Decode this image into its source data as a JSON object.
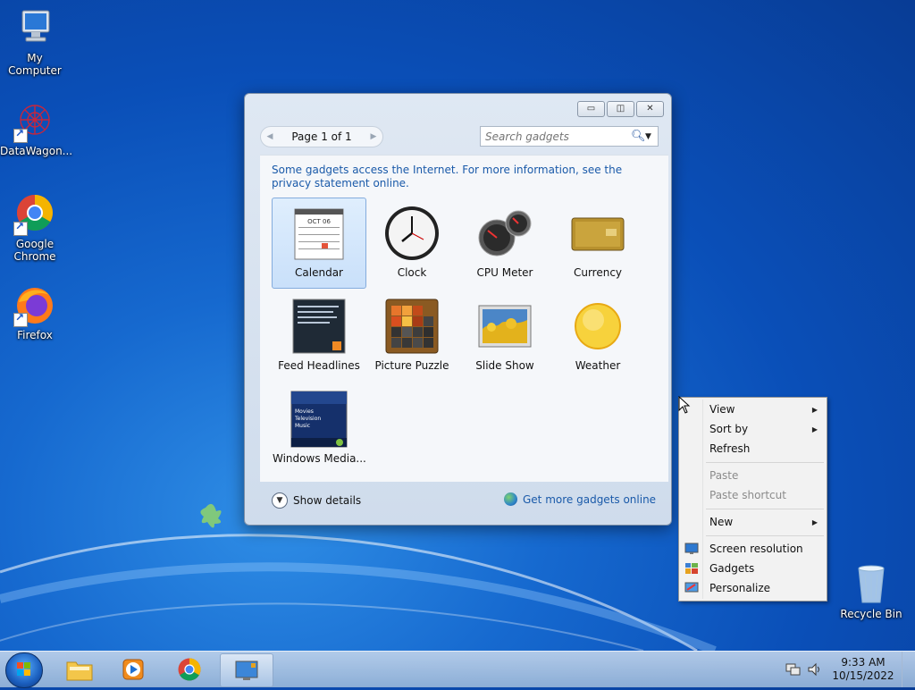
{
  "desktop": {
    "icons": [
      {
        "label": "My Computer"
      },
      {
        "label": "DataWagon..."
      },
      {
        "label": "Google Chrome"
      },
      {
        "label": "Firefox"
      },
      {
        "label": "Recycle Bin"
      }
    ]
  },
  "gadgets_window": {
    "pager_label": "Page 1 of 1",
    "search_placeholder": "Search gadgets",
    "notice": "Some gadgets access the Internet.  For more information, see the privacy statement online.",
    "items": [
      {
        "name": "Calendar",
        "selected": true
      },
      {
        "name": "Clock"
      },
      {
        "name": "CPU Meter"
      },
      {
        "name": "Currency"
      },
      {
        "name": "Feed Headlines"
      },
      {
        "name": "Picture Puzzle"
      },
      {
        "name": "Slide Show"
      },
      {
        "name": "Weather"
      },
      {
        "name": "Windows Media..."
      }
    ],
    "calendar_thumb_month": "OCT 06",
    "media_thumb_lines": [
      "Movies",
      "Television",
      "Music"
    ],
    "show_details": "Show details",
    "get_more": "Get more gadgets online"
  },
  "context_menu": {
    "items": [
      {
        "label": "View",
        "submenu": true
      },
      {
        "label": "Sort by",
        "submenu": true
      },
      {
        "label": "Refresh"
      },
      {
        "label": "Paste",
        "disabled": true
      },
      {
        "label": "Paste shortcut",
        "disabled": true
      },
      {
        "label": "New",
        "submenu": true
      },
      {
        "label": "Screen resolution",
        "icon": "screen-resolution-icon"
      },
      {
        "label": "Gadgets",
        "icon": "gadgets-icon"
      },
      {
        "label": "Personalize",
        "icon": "personalize-icon"
      }
    ]
  },
  "taskbar": {
    "time": "9:33 AM",
    "date": "10/15/2022"
  },
  "colors": {
    "link_blue": "#1a5aa9",
    "desktop_blue": "#0a4fb8"
  }
}
